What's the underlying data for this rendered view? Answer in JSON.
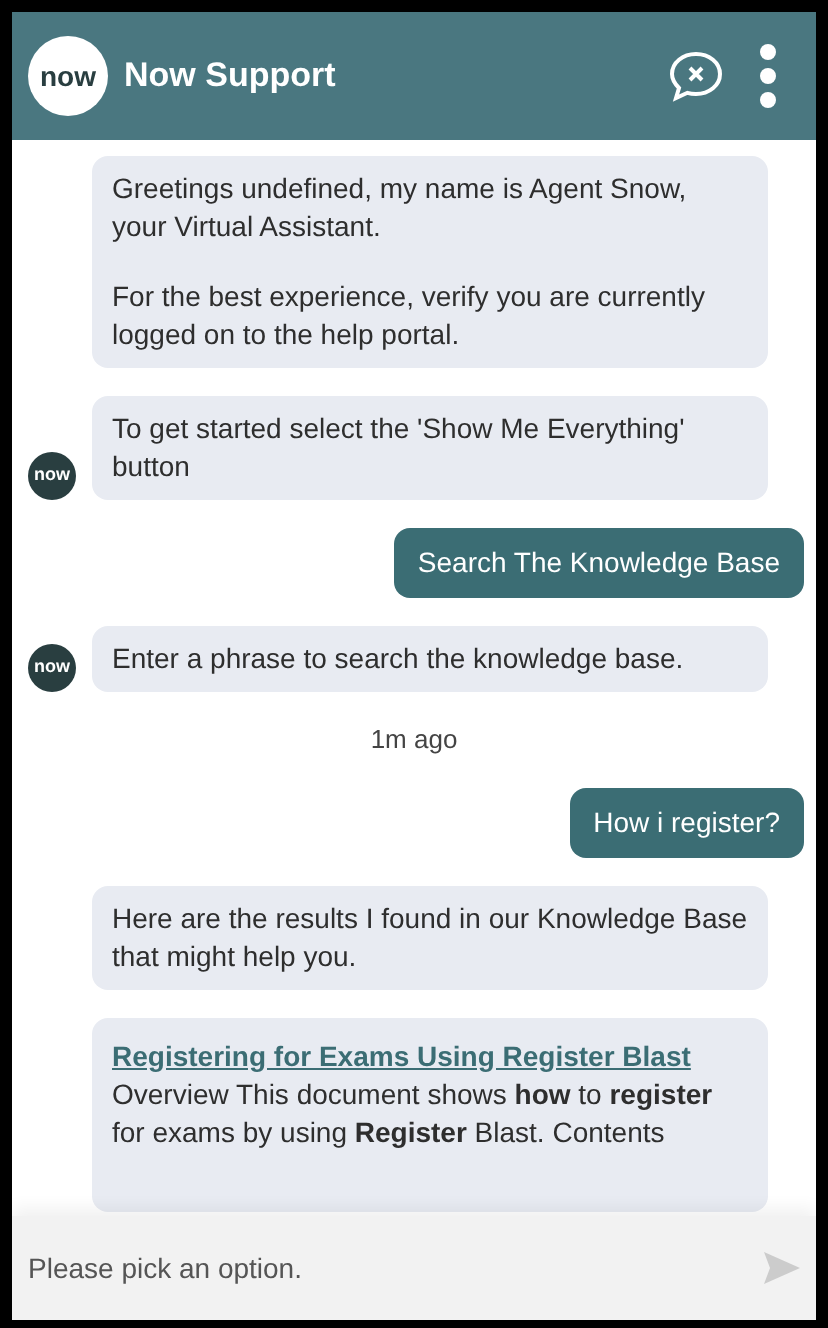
{
  "header": {
    "logo": "now",
    "title": "Now Support"
  },
  "messages": [
    {
      "kind": "bot",
      "avatar": false,
      "paragraphs": [
        "Greetings undefined, my name is Agent Snow, your Virtual Assistant.",
        "For the best experience, verify you are currently logged on to the help portal."
      ]
    },
    {
      "kind": "bot",
      "avatar": true,
      "avatar_text": "now",
      "paragraphs": [
        "To get started select the 'Show Me Everything' button"
      ]
    },
    {
      "kind": "user",
      "text": "Search The Knowledge Base"
    },
    {
      "kind": "bot",
      "avatar": true,
      "avatar_text": "now",
      "paragraphs": [
        "Enter a phrase to search the knowledge base."
      ]
    },
    {
      "kind": "time",
      "text": "1m ago"
    },
    {
      "kind": "user",
      "text": "How i register?"
    },
    {
      "kind": "bot",
      "avatar": false,
      "paragraphs": [
        "Here are the results I found in our Knowledge Base that might help you."
      ]
    },
    {
      "kind": "article",
      "title": "Registering for Exams Using Register Blast",
      "snippet": "Overview This document shows **how** to **register** for exams by using **Register** Blast. Contents"
    }
  ],
  "composer": {
    "placeholder": "Please pick an option."
  }
}
